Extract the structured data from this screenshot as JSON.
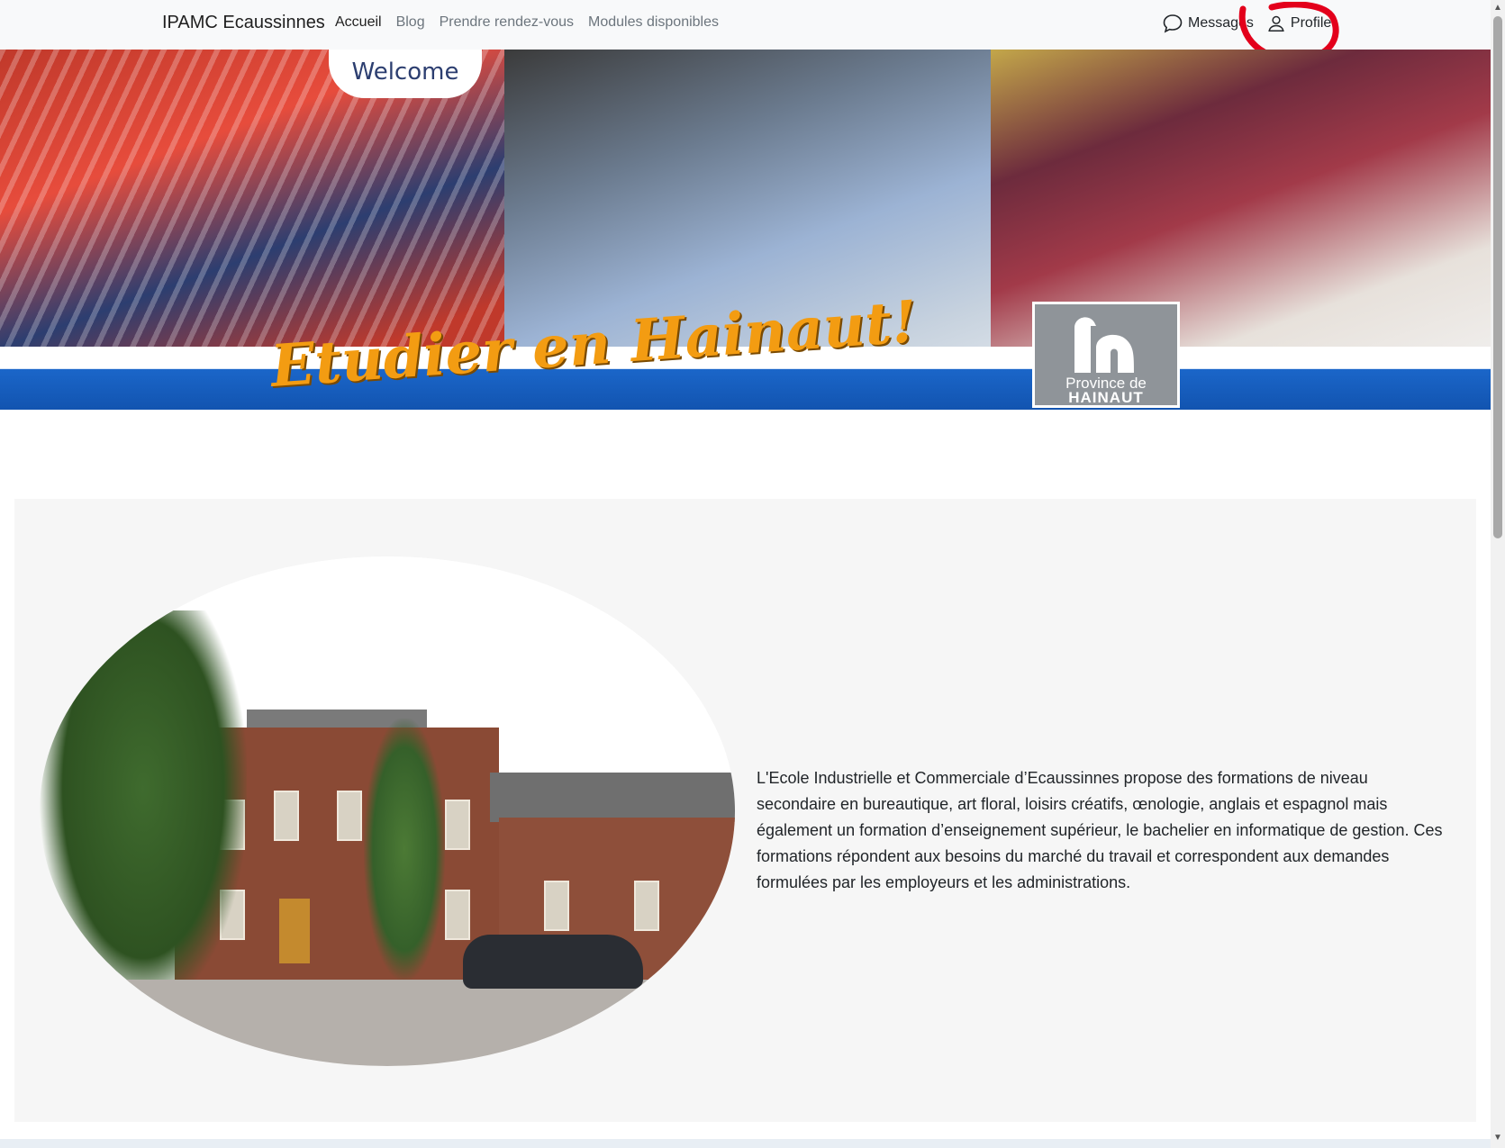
{
  "navbar": {
    "brand": "IPAMC Ecaussinnes",
    "links": [
      {
        "label": "Accueil",
        "active": true
      },
      {
        "label": "Blog",
        "active": false
      },
      {
        "label": "Prendre rendez-vous",
        "active": false
      },
      {
        "label": "Modules disponibles",
        "active": false
      }
    ],
    "messages_label": "Messages",
    "profile_label": "Profile",
    "icons": {
      "messages": "chat-bubble-icon",
      "profile": "person-icon"
    },
    "highlight_color": "#e3001b"
  },
  "banner": {
    "welcome_text": "Welcome",
    "slogan": "Etudier en Hainaut!",
    "logo_line1": "Province de",
    "logo_line2": "HAINAUT",
    "brand_blue": "#1b66c9"
  },
  "about": {
    "text": "L'Ecole Industrielle et Commerciale d’Ecaussinnes propose des formations de niveau secondaire en bureautique, art floral, loisirs créatifs, œnologie, anglais et espagnol mais également un formation d’enseignement supérieur, le bachelier en informatique de gestion. Ces formations répondent aux besoins du marché du travail et correspondent aux demandes formulées par les employeurs et les administrations."
  }
}
